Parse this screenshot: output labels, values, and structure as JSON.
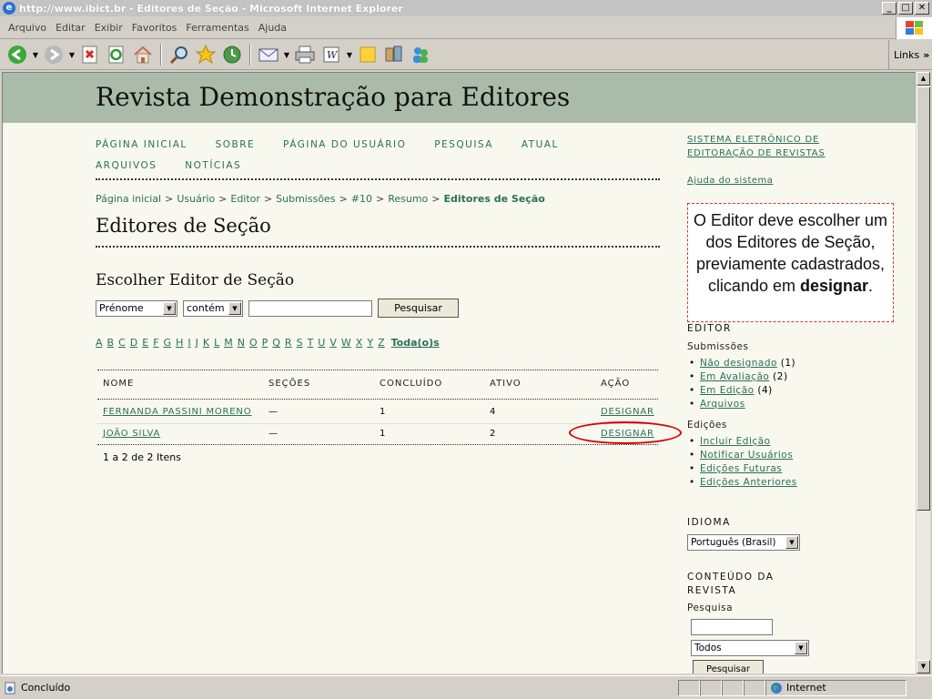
{
  "window": {
    "title": "http://www.ibict.br - Editores de Seção - Microsoft Internet Explorer",
    "min": "_",
    "max": "□",
    "close": "✕"
  },
  "menu": [
    "Arquivo",
    "Editar",
    "Exibir",
    "Favoritos",
    "Ferramentas",
    "Ajuda"
  ],
  "toolbar": {
    "links_label": "Links"
  },
  "site": {
    "title": "Revista Demonstração para Editores"
  },
  "nav": [
    "PÁGINA INICIAL",
    "SOBRE",
    "PÁGINA DO USUÁRIO",
    "PESQUISA",
    "ATUAL",
    "ARQUIVOS",
    "NOTÍCIAS"
  ],
  "breadcrumb": {
    "items": [
      "Página inicial",
      "Usuário",
      "Editor",
      "Submissões",
      "#10",
      "Resumo"
    ],
    "current": "Editores de Seção",
    "sep": ">"
  },
  "page": {
    "title": "Editores de Seção",
    "subtitle": "Escolher Editor de Seção",
    "search": {
      "field": "Prénome",
      "match": "contém",
      "button": "Pesquisar"
    },
    "alphabet": [
      "A",
      "B",
      "C",
      "D",
      "E",
      "F",
      "G",
      "H",
      "I",
      "J",
      "K",
      "L",
      "M",
      "N",
      "O",
      "P",
      "Q",
      "R",
      "S",
      "T",
      "U",
      "V",
      "W",
      "X",
      "Y",
      "Z"
    ],
    "all_label": "Toda(o)s",
    "table": {
      "headers": [
        "NOME",
        "SEÇÕES",
        "CONCLUÍDO",
        "ATIVO",
        "AÇÃO"
      ],
      "rows": [
        {
          "name": "FERNANDA PASSINI MORENO",
          "sections": "—",
          "done": "1",
          "active": "4",
          "action": "DESIGNAR"
        },
        {
          "name": "JOÃO SILVA",
          "sections": "—",
          "done": "1",
          "active": "2",
          "action": "DESIGNAR"
        }
      ]
    },
    "count_text": "1 a 2 de 2 Itens"
  },
  "callout": {
    "pre": "O Editor deve escolher um dos Editores de Seção, previamente cadastrados, clicando em ",
    "bold": "designar",
    "post": "."
  },
  "sidebar": {
    "system_link": "SISTEMA ELETRÔNICO DE EDITORAÇÃO DE REVISTAS",
    "help": "Ajuda do sistema",
    "editor_heading": "EDITOR",
    "submissions_label": "Submissões",
    "submissions": [
      {
        "label": "Não designado",
        "count": "(1)"
      },
      {
        "label": "Em Avaliação",
        "count": "(2)"
      },
      {
        "label": "Em Edição",
        "count": "(4)"
      },
      {
        "label": "Arquivos",
        "count": ""
      }
    ],
    "issues_label": "Edições",
    "issues": [
      "Incluir Edição",
      "Notificar Usuários",
      "Edições Futuras",
      "Edições Anteriores"
    ],
    "language_heading": "IDIOMA",
    "language_value": "Português (Brasil)",
    "content_heading": "CONTEÚDO DA REVISTA",
    "search_label": "Pesquisa",
    "scope_value": "Todos",
    "search_button": "Pesquisar"
  },
  "status": {
    "text": "Concluído",
    "zone": "Internet"
  }
}
